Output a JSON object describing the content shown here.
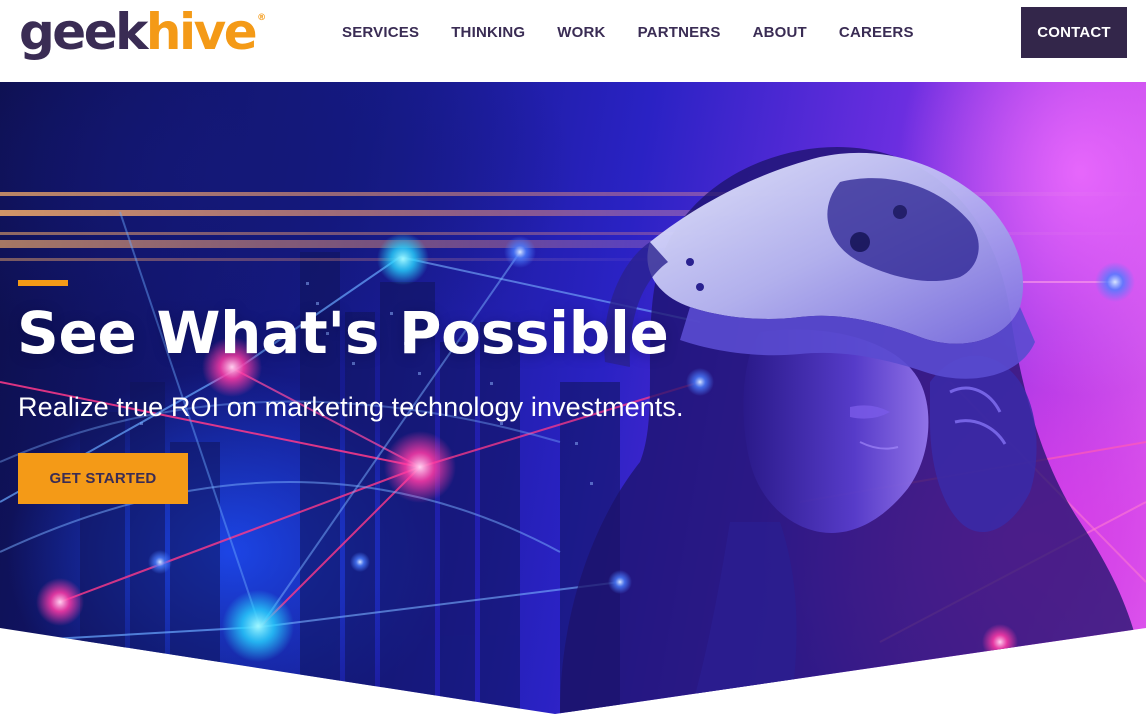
{
  "brand": {
    "logo_part1": "geek",
    "logo_part2": "hive",
    "logo_mark": "®",
    "colors": {
      "primary": "#3a2c54",
      "accent": "#f49a17",
      "contact_bg": "#33264a"
    }
  },
  "nav": {
    "items": [
      {
        "label": "SERVICES"
      },
      {
        "label": "THINKING"
      },
      {
        "label": "WORK"
      },
      {
        "label": "PARTNERS"
      },
      {
        "label": "ABOUT"
      },
      {
        "label": "CAREERS"
      }
    ],
    "contact_label": "CONTACT"
  },
  "hero": {
    "title": "See What's Possible",
    "subtitle": "Realize true ROI on marketing technology investments.",
    "cta_label": "GET STARTED",
    "image_description_icon": "vr-headset-woman-network-image"
  }
}
